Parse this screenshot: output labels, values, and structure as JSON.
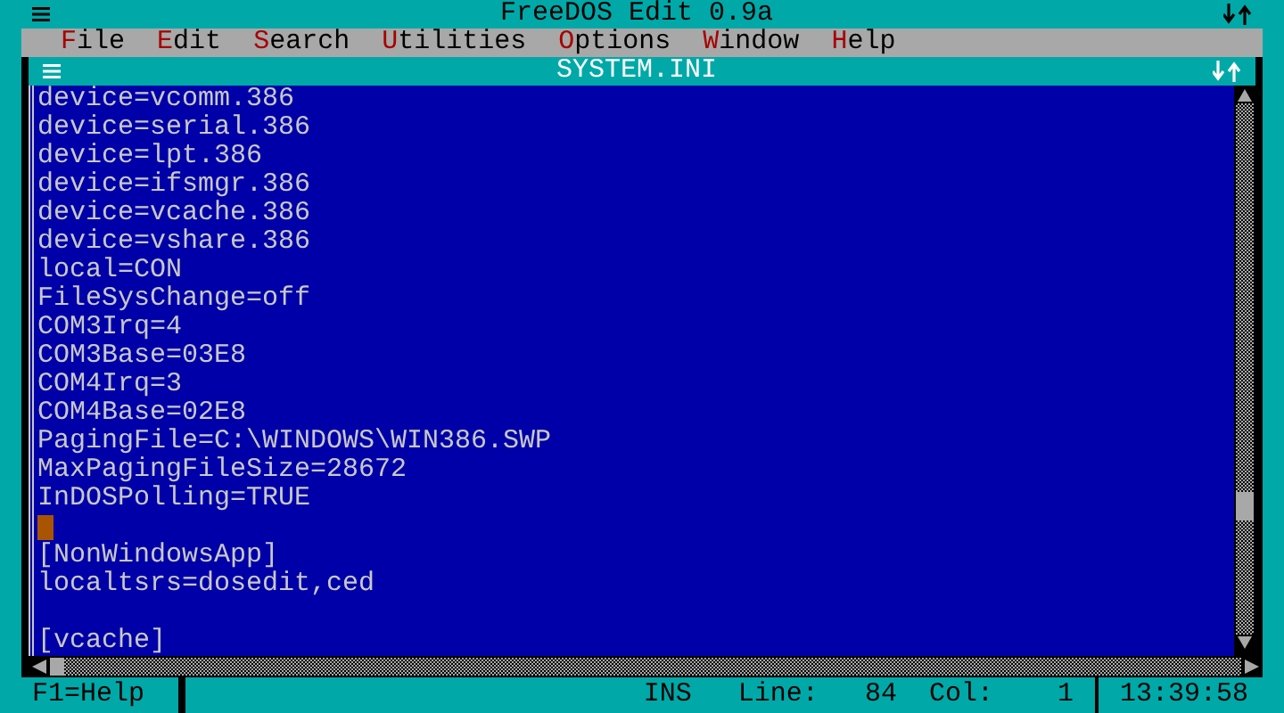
{
  "window": {
    "title": "FreeDOS Edit 0.9a"
  },
  "menu": [
    {
      "hotkey": "F",
      "rest": "ile"
    },
    {
      "hotkey": "E",
      "rest": "dit"
    },
    {
      "hotkey": "S",
      "rest": "earch"
    },
    {
      "hotkey": "U",
      "rest": "tilities"
    },
    {
      "hotkey": "O",
      "rest": "ptions"
    },
    {
      "hotkey": "W",
      "rest": "indow"
    },
    {
      "hotkey": "H",
      "rest": "elp"
    }
  ],
  "document": {
    "title": "SYSTEM.INI",
    "lines": [
      {
        "kind": "text",
        "text": "device=vcomm.386"
      },
      {
        "kind": "text",
        "text": "device=serial.386"
      },
      {
        "kind": "text",
        "text": "device=lpt.386"
      },
      {
        "kind": "text",
        "text": "device=ifsmgr.386"
      },
      {
        "kind": "text",
        "text": "device=vcache.386"
      },
      {
        "kind": "text",
        "text": "device=vshare.386"
      },
      {
        "kind": "text",
        "text": "local=CON"
      },
      {
        "kind": "text",
        "text": "FileSysChange=off"
      },
      {
        "kind": "text",
        "text": "COM3Irq=4"
      },
      {
        "kind": "text",
        "text": "COM3Base=03E8"
      },
      {
        "kind": "text",
        "text": "COM4Irq=3"
      },
      {
        "kind": "text",
        "text": "COM4Base=02E8"
      },
      {
        "kind": "text",
        "text": "PagingFile=C:\\WINDOWS\\WIN386.SWP"
      },
      {
        "kind": "text",
        "text": "MaxPagingFileSize=28672"
      },
      {
        "kind": "text",
        "text": "InDOSPolling=TRUE"
      },
      {
        "kind": "cursor"
      },
      {
        "kind": "text",
        "text": "[NonWindowsApp]"
      },
      {
        "kind": "text",
        "text": "localtsrs=dosedit,ced"
      },
      {
        "kind": "blank"
      },
      {
        "kind": "text",
        "text": "[vcache]"
      }
    ]
  },
  "status_bar": {
    "help": "F1=Help",
    "mode": "INS",
    "line_label": "Line:",
    "line_value": "84",
    "col_label": "Col:",
    "col_value": "1",
    "time": "13:39:58"
  }
}
